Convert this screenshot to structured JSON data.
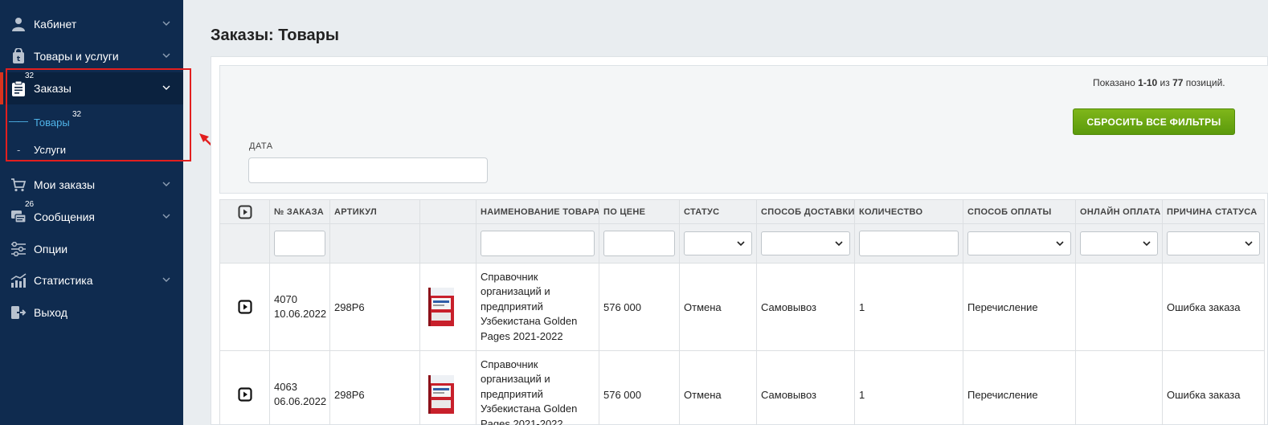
{
  "sidebar": {
    "items": [
      {
        "label": "Кабинет",
        "icon": "user-icon"
      },
      {
        "label": "Товары и услуги",
        "icon": "shopping-bag-icon"
      },
      {
        "label": "Заказы",
        "icon": "orders-clipboard-icon",
        "badge": "32"
      },
      {
        "label": "Мои заказы",
        "icon": "cart-icon"
      },
      {
        "label": "Сообщения",
        "icon": "messages-icon",
        "badge": "26"
      },
      {
        "label": "Опции",
        "icon": "sliders-icon"
      },
      {
        "label": "Статистика",
        "icon": "stats-chart-icon"
      },
      {
        "label": "Выход",
        "icon": "logout-icon"
      }
    ],
    "subitems": [
      {
        "label": "Товары",
        "badge": "32",
        "prefix": "——"
      },
      {
        "label": "Услуги",
        "prefix": "-"
      }
    ]
  },
  "page": {
    "title": "Заказы: Товары"
  },
  "filters": {
    "summary_prefix": "Показано ",
    "summary_range": "1-10",
    "summary_mid": " из ",
    "summary_total": "77",
    "summary_suffix": " позиций.",
    "reset_label": "СБРОСИТЬ ВСЕ ФИЛЬТРЫ",
    "date_label": "ДАТА",
    "date_value": ""
  },
  "table": {
    "columns": [
      "№ ЗАКАЗА",
      "АРТИКУЛ",
      "",
      "НАИМЕНОВАНИЕ ТОВАРА",
      "ПО ЦЕНЕ",
      "СТАТУС",
      "СПОСОБ ДОСТАВКИ",
      "КОЛИЧЕСТВО",
      "СПОСОБ ОПЛАТЫ",
      "ОНЛАЙН ОПЛАТА",
      "ПРИЧИНА СТАТУСА"
    ],
    "rows": [
      {
        "order_no": "4070",
        "order_date": "10.06.2022",
        "sku": "298P6",
        "name": "Справочник организаций и предприятий Узбекистана Golden Pages 2021-2022",
        "price": "576 000",
        "status": "Отмена",
        "delivery": "Самовывоз",
        "qty": "1",
        "payment": "Перечисление",
        "online": "",
        "reason": "Ошибка заказа"
      },
      {
        "order_no": "4063",
        "order_date": "06.06.2022",
        "sku": "298P6",
        "name": "Справочник организаций и предприятий Узбекистана Golden Pages 2021-2022",
        "price": "576 000",
        "status": "Отмена",
        "delivery": "Самовывоз",
        "qty": "1",
        "payment": "Перечисление",
        "online": "",
        "reason": "Ошибка заказа"
      }
    ]
  },
  "colors": {
    "sidebar_bg": "#0f2b4f",
    "accent_red": "#e21f1f",
    "active_link": "#4fb3e8",
    "button_green": "#6aa812"
  }
}
